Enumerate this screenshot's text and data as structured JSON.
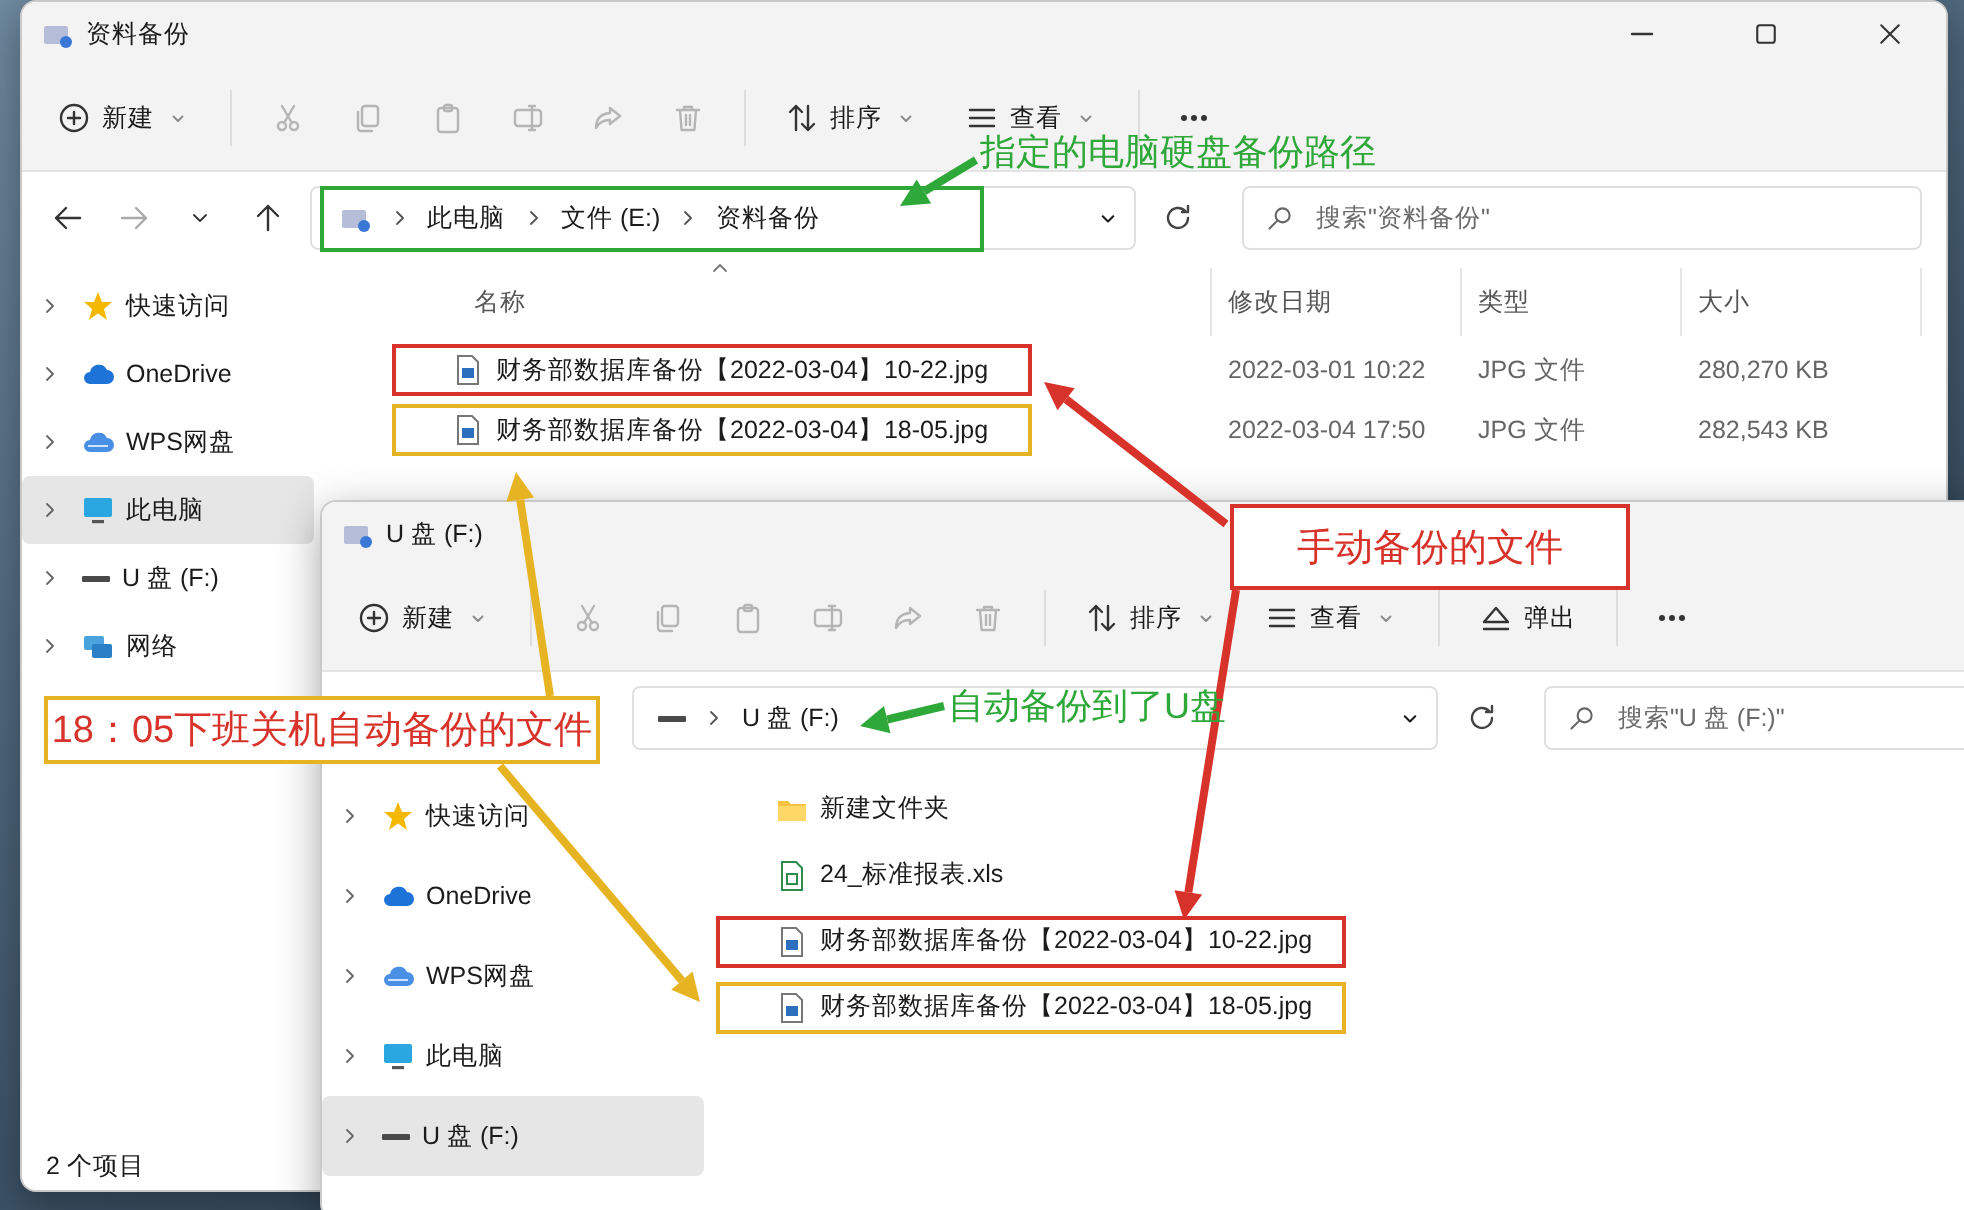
{
  "windows": [
    {
      "title": "资料备份",
      "window_controls": true,
      "nav_buttons": true,
      "toolbar": [
        {
          "kind": "new",
          "label": "新建",
          "dropdown": true,
          "disabled": false
        },
        {
          "kind": "cut",
          "disabled": true
        },
        {
          "kind": "copy",
          "disabled": true
        },
        {
          "kind": "paste",
          "disabled": true
        },
        {
          "kind": "rename",
          "disabled": true
        },
        {
          "kind": "share",
          "disabled": true
        },
        {
          "kind": "delete",
          "disabled": true
        },
        {
          "kind": "sort",
          "label": "排序",
          "dropdown": true,
          "disabled": false
        },
        {
          "kind": "view",
          "label": "查看",
          "dropdown": true,
          "disabled": false
        },
        {
          "kind": "more",
          "disabled": false
        }
      ],
      "address": {
        "kind": "pc",
        "crumbs": [
          "此电脑",
          "文件 (E:)",
          "资料备份"
        ],
        "color": "#2fa83a"
      },
      "search": {
        "placeholder": "搜索\"资料备份\""
      },
      "sidebar": [
        {
          "label": "快速访问",
          "kind": "star",
          "selected": false
        },
        {
          "label": "OneDrive",
          "kind": "cloud",
          "selected": false
        },
        {
          "label": "WPS网盘",
          "kind": "wps",
          "selected": false
        },
        {
          "label": "此电脑",
          "kind": "pc",
          "selected": true
        },
        {
          "label": "U 盘 (F:)",
          "kind": "drive",
          "selected": false
        },
        {
          "label": "网络",
          "kind": "network",
          "selected": false
        }
      ],
      "columns": [
        {
          "label": "名称",
          "sorted": true
        },
        {
          "label": "修改日期",
          "sorted": false
        },
        {
          "label": "类型",
          "sorted": false
        },
        {
          "label": "大小",
          "sorted": false
        }
      ],
      "files": [
        {
          "name": "财务部数据库备份【2022-03-04】10-22.jpg",
          "kind": "image",
          "modified": "2022-03-01 10:22",
          "type": "JPG 文件",
          "size": "280,270 KB",
          "color": "#d8332a"
        },
        {
          "name": "财务部数据库备份【2022-03-04】18-05.jpg",
          "kind": "image",
          "modified": "2022-03-04 17:50",
          "type": "JPG 文件",
          "size": "282,543 KB",
          "color": "#e6b422"
        }
      ],
      "status_bar": "2 个项目"
    },
    {
      "title": "U 盘 (F:)",
      "toolbar": [
        {
          "kind": "new",
          "label": "新建",
          "dropdown": true,
          "disabled": false
        },
        {
          "kind": "cut",
          "disabled": true
        },
        {
          "kind": "copy",
          "disabled": true
        },
        {
          "kind": "paste",
          "disabled": true
        },
        {
          "kind": "rename",
          "disabled": true
        },
        {
          "kind": "share",
          "disabled": true
        },
        {
          "kind": "delete",
          "disabled": true
        },
        {
          "kind": "sort",
          "label": "排序",
          "dropdown": true,
          "disabled": false
        },
        {
          "kind": "view",
          "label": "查看",
          "dropdown": true,
          "disabled": false
        },
        {
          "kind": "eject",
          "label": "弹出",
          "disabled": false
        },
        {
          "kind": "more",
          "disabled": false
        }
      ],
      "address": {
        "kind": "drive",
        "crumbs": [
          "U 盘 (F:)"
        ]
      },
      "search": {
        "placeholder": "搜索\"U 盘 (F:)\""
      },
      "sidebar": [
        {
          "label": "快速访问",
          "kind": "star",
          "selected": false
        },
        {
          "label": "OneDrive",
          "kind": "cloud",
          "selected": false
        },
        {
          "label": "WPS网盘",
          "kind": "wps",
          "selected": false
        },
        {
          "label": "此电脑",
          "kind": "pc",
          "selected": false
        },
        {
          "label": "U 盘 (F:)",
          "kind": "drive",
          "selected": true
        }
      ],
      "files": [
        {
          "name": "新建文件夹",
          "kind": "folder"
        },
        {
          "name": "24_标准报表.xls",
          "kind": "sheet"
        },
        {
          "name": "财务部数据库备份【2022-03-04】10-22.jpg",
          "kind": "image",
          "color": "#d8332a"
        },
        {
          "name": "财务部数据库备份【2022-03-04】18-05.jpg",
          "kind": "image",
          "color": "#e6b422"
        }
      ]
    }
  ],
  "annotations": [
    {
      "kind": "label",
      "text": "指定的电脑硬盘备份路径",
      "color": "#2fa83a"
    },
    {
      "kind": "callout",
      "text": "手动备份的文件",
      "color": "#d8332a"
    },
    {
      "kind": "callout",
      "text": "18：05下班关机自动备份的文件",
      "color": "#e6b422"
    },
    {
      "kind": "label",
      "text": "自动备份到了U盘",
      "color": "#2fa83a"
    }
  ]
}
